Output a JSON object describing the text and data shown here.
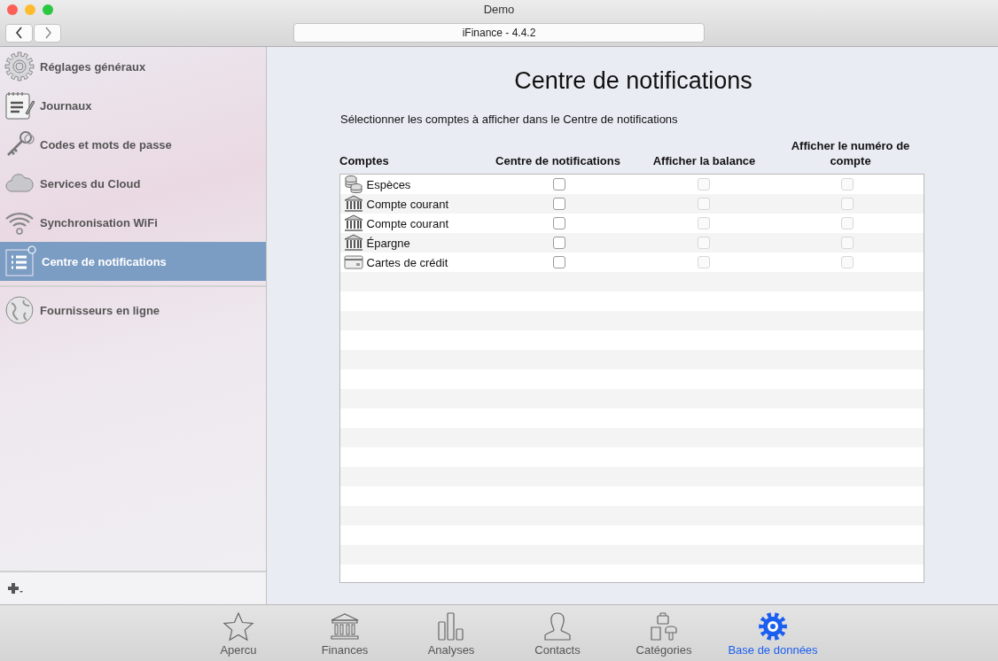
{
  "window": {
    "title": "Demo",
    "address": "iFinance - 4.4.2"
  },
  "sidebar": {
    "items": [
      {
        "label": "Réglages généraux",
        "selected": false
      },
      {
        "label": "Journaux",
        "selected": false
      },
      {
        "label": "Codes et mots de passe",
        "selected": false
      },
      {
        "label": "Services du Cloud",
        "selected": false
      },
      {
        "label": "Synchronisation WiFi",
        "selected": false
      },
      {
        "label": "Centre de notifications",
        "selected": true
      }
    ],
    "extra_items": [
      {
        "label": "Fournisseurs en ligne",
        "selected": false
      }
    ]
  },
  "content": {
    "title": "Centre de notifications",
    "description": "Sélectionner les comptes à afficher dans le Centre de notifications",
    "table": {
      "columns": [
        "Comptes",
        "Centre de notifications",
        "Afficher la balance",
        "Afficher le numéro de compte"
      ],
      "rows": [
        {
          "name": "Espèces",
          "kind": "coins",
          "notify": {
            "checked": false,
            "disabled": false
          },
          "balance": {
            "checked": false,
            "disabled": true
          },
          "number": {
            "checked": false,
            "disabled": true
          }
        },
        {
          "name": "Compte courant",
          "kind": "bank",
          "notify": {
            "checked": false,
            "disabled": false
          },
          "balance": {
            "checked": false,
            "disabled": true
          },
          "number": {
            "checked": false,
            "disabled": true
          }
        },
        {
          "name": "Compte courant",
          "kind": "bank",
          "notify": {
            "checked": false,
            "disabled": false
          },
          "balance": {
            "checked": false,
            "disabled": true
          },
          "number": {
            "checked": false,
            "disabled": true
          }
        },
        {
          "name": "Épargne",
          "kind": "bank",
          "notify": {
            "checked": false,
            "disabled": false
          },
          "balance": {
            "checked": false,
            "disabled": true
          },
          "number": {
            "checked": false,
            "disabled": true
          }
        },
        {
          "name": "Cartes de crédit",
          "kind": "card",
          "notify": {
            "checked": false,
            "disabled": false
          },
          "balance": {
            "checked": false,
            "disabled": true
          },
          "number": {
            "checked": false,
            "disabled": true
          }
        }
      ]
    }
  },
  "tab_bar": [
    {
      "label": "Apercu",
      "selected": false
    },
    {
      "label": "Finances",
      "selected": false
    },
    {
      "label": "Analyses",
      "selected": false
    },
    {
      "label": "Contacts",
      "selected": false
    },
    {
      "label": "Catégories",
      "selected": false
    },
    {
      "label": "Base de données",
      "selected": true
    }
  ]
}
